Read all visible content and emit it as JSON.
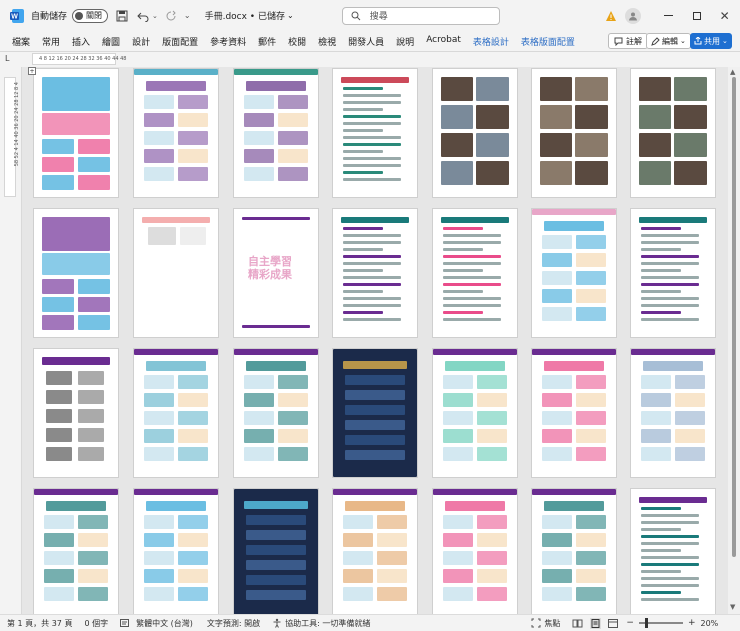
{
  "titlebar": {
    "autosave_label": "自動儲存",
    "autosave_state": "關閉",
    "document_title": "手冊.docx • 已儲存",
    "search_placeholder": "搜尋",
    "user_initial": ""
  },
  "menu": {
    "items": [
      "檔案",
      "常用",
      "插入",
      "繪圖",
      "設計",
      "版面配置",
      "參考資料",
      "郵件",
      "校閱",
      "檢視",
      "開發人員",
      "說明",
      "Acrobat",
      "表格設計",
      "表格版面配置"
    ],
    "contextual_items": [
      "表格設計",
      "表格版面配置"
    ],
    "comments_label": "註解",
    "editing_label": "編輯",
    "share_label": "共用"
  },
  "ruler": {
    "horizontal_ticks": "4  8 12 16 20 24 28 32 36 40 44 48",
    "vertical_ticks": "58 52 4 14 40 36 20 24 28 12 8 4"
  },
  "pages": {
    "rows": 4,
    "cols": 7,
    "page6_text": "自主學習\n精彩成果",
    "colors": {
      "purple": "#6a2c91",
      "teal": "#1a7a7a",
      "dark_navy": "#1b2a4a",
      "pink": "#e8a6c8",
      "photo_dark": "#5a4a40"
    }
  },
  "status": {
    "page_info": "第 1 頁，共 37 頁",
    "word_count": "0 個字",
    "language": "繁體中文 (台灣)",
    "text_prediction": "文字預測: 開啟",
    "accessibility": "協助工具: 一切準備就緒",
    "focus_label": "焦點",
    "zoom_level": "20%"
  }
}
